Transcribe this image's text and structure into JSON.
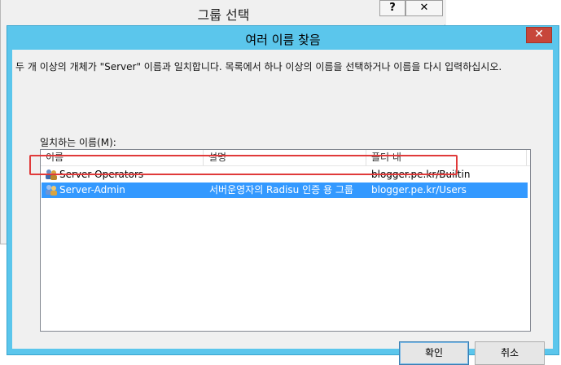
{
  "background_dialog": {
    "title": "그룹 선택",
    "help_label": "?",
    "close_label": "✕"
  },
  "dialog": {
    "title": "여러 이름 찾음",
    "close_label": "✕",
    "description": "두 개 이상의 개체가 \"Server\" 이름과 일치합니다. 목록에서 하나 이상의 이름을 선택하거나 이름을 다시 입력하십시오.",
    "list_label": "일치하는 이름(M):",
    "columns": [
      "이름",
      "설명",
      "폴더 내"
    ],
    "rows": [
      {
        "name": "Server Operators",
        "description": "",
        "folder": "blogger.pe.kr/Builtin",
        "icon": "group-icon",
        "selected": false
      },
      {
        "name": "Server-Admin",
        "description": "서버운영자의 Radisu 인증 용 그룹",
        "folder": "blogger.pe.kr/Users",
        "icon": "group-icon",
        "selected": true
      }
    ],
    "ok_label": "확인",
    "cancel_label": "취소"
  },
  "colors": {
    "accent_frame": "#5bc6ec",
    "selection": "#3399ff",
    "annotation_box": "#e03a3a",
    "close_button": "#c7463a"
  }
}
